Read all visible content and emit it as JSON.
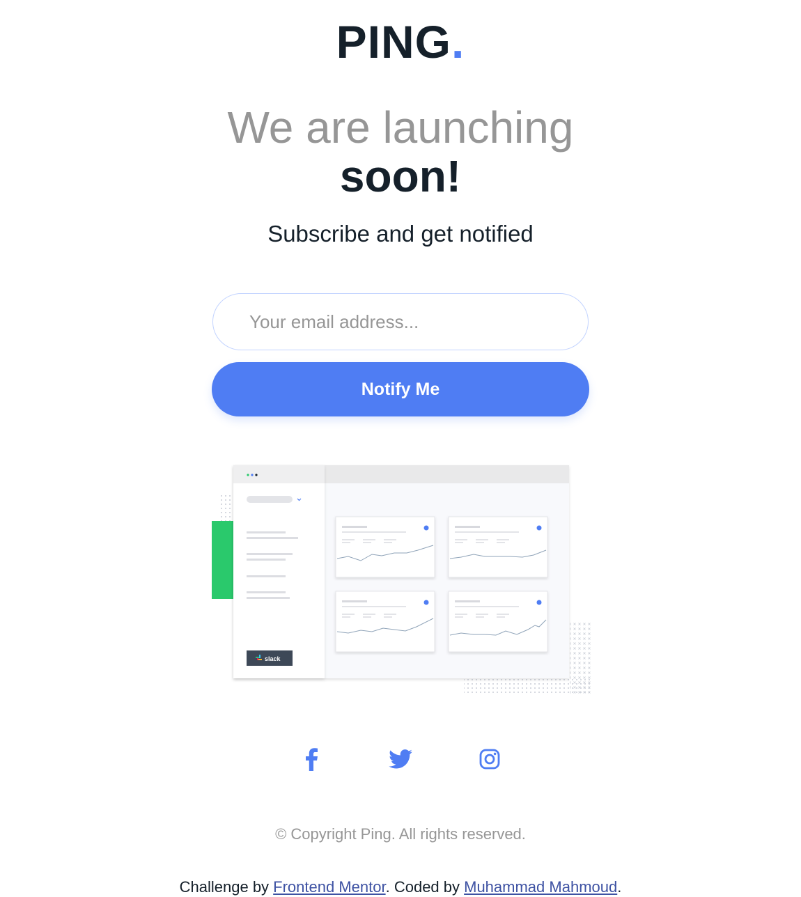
{
  "brand": {
    "name": "PING",
    "dot": "."
  },
  "hero": {
    "headline_light": "We are launching",
    "headline_bold": "soon!",
    "subtitle": "Subscribe and get notified"
  },
  "form": {
    "email_placeholder": "Your email address...",
    "email_value": "",
    "submit_label": "Notify Me"
  },
  "illustration": {
    "badge_label": "slack"
  },
  "social": [
    {
      "icon": "facebook-icon"
    },
    {
      "icon": "twitter-icon"
    },
    {
      "icon": "instagram-icon"
    }
  ],
  "footer": {
    "copyright": "© Copyright Ping. All rights reserved.",
    "credit_prefix": "Challenge by ",
    "credit_link1": "Frontend Mentor",
    "credit_middle": ". Coded by ",
    "credit_link2": "Muhammad Mahmoud",
    "credit_suffix": "."
  },
  "colors": {
    "primary": "#4f7df3",
    "dark": "#15202a",
    "gray": "#969696",
    "light_border": "#c2d3ff",
    "accent_green": "#2ac96c"
  }
}
